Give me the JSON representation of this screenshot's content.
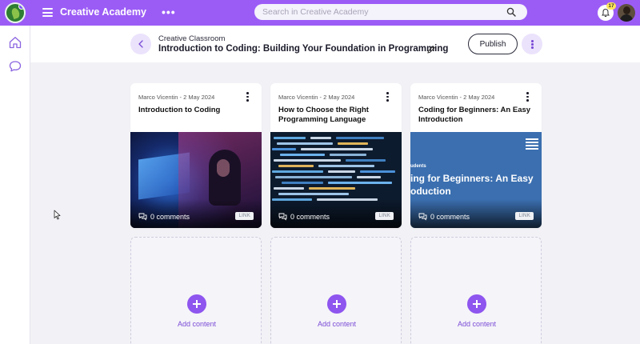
{
  "app": {
    "title": "Creative Academy",
    "search_placeholder": "Search in Creative Academy",
    "notification_count": "17",
    "accent_color": "#9b5cf6"
  },
  "icons": {
    "menu": "hamburger-icon",
    "more": "more-horizontal-icon",
    "search": "search-icon",
    "notifications": "bell-icon",
    "home": "home-icon",
    "messages": "chat-bubble-icon",
    "back": "chevron-left-icon",
    "edit": "pencil-icon",
    "options": "more-vertical-icon",
    "comments": "comments-icon",
    "add": "plus-icon"
  },
  "header": {
    "breadcrumb": "Creative Classroom",
    "title": "Introduction to Coding: Building Your Foundation in Programming",
    "publish_label": "Publish"
  },
  "cards": [
    {
      "meta": "Marco Vicentin - 2 May 2024",
      "title": "Introduction to Coding",
      "comments": "0 comments",
      "tag": "LINK"
    },
    {
      "meta": "Marco Vicentin - 2 May 2024",
      "title": "How to Choose the Right Programming Language",
      "comments": "0 comments",
      "tag": "LINK"
    },
    {
      "meta": "Marco Vicentin - 2 May 2024",
      "title": "Coding for Beginners: An Easy Introduction",
      "comments": "0 comments",
      "tag": "LINK",
      "thumb_label": "udents",
      "thumb_text_line1": "ing for Beginners: An Easy",
      "thumb_text_line2": "oduction"
    }
  ],
  "add_slots": [
    {
      "label": "Add content"
    },
    {
      "label": "Add content"
    },
    {
      "label": "Add content"
    }
  ]
}
